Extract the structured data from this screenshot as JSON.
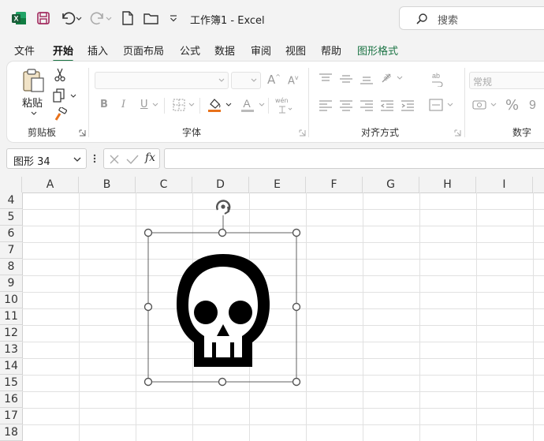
{
  "titlebar": {
    "title": "工作簿1  -  Excel",
    "search_placeholder": "搜索"
  },
  "menu": {
    "items": [
      "文件",
      "开始",
      "插入",
      "页面布局",
      "公式",
      "数据",
      "审阅",
      "视图",
      "帮助",
      "图形格式"
    ],
    "active": "开始"
  },
  "ribbon": {
    "clipboard": {
      "paste_label": "粘贴",
      "group_label": "剪贴板"
    },
    "font": {
      "group_label": "字体",
      "phonetic_label": "wén"
    },
    "alignment": {
      "group_label": "对齐方式"
    },
    "number": {
      "format_value": "常规",
      "group_label": "数字"
    }
  },
  "formula_bar": {
    "name_box": "图形 34",
    "fx_label": "fx",
    "formula": ""
  },
  "sheet": {
    "columns": [
      "A",
      "B",
      "C",
      "D",
      "E",
      "F",
      "G",
      "H",
      "I"
    ],
    "rows": [
      "4",
      "5",
      "6",
      "7",
      "8",
      "9",
      "10",
      "11",
      "12",
      "13",
      "14",
      "15",
      "16",
      "17",
      "18"
    ]
  },
  "colors": {
    "accent": "#1a7343",
    "excel_green": "#107c41",
    "fill_orange": "#e8711a",
    "selection_border": "#606060"
  },
  "icons": {
    "graphic": "skull-icon",
    "rotate_handle": "rotate-handle-icon"
  }
}
